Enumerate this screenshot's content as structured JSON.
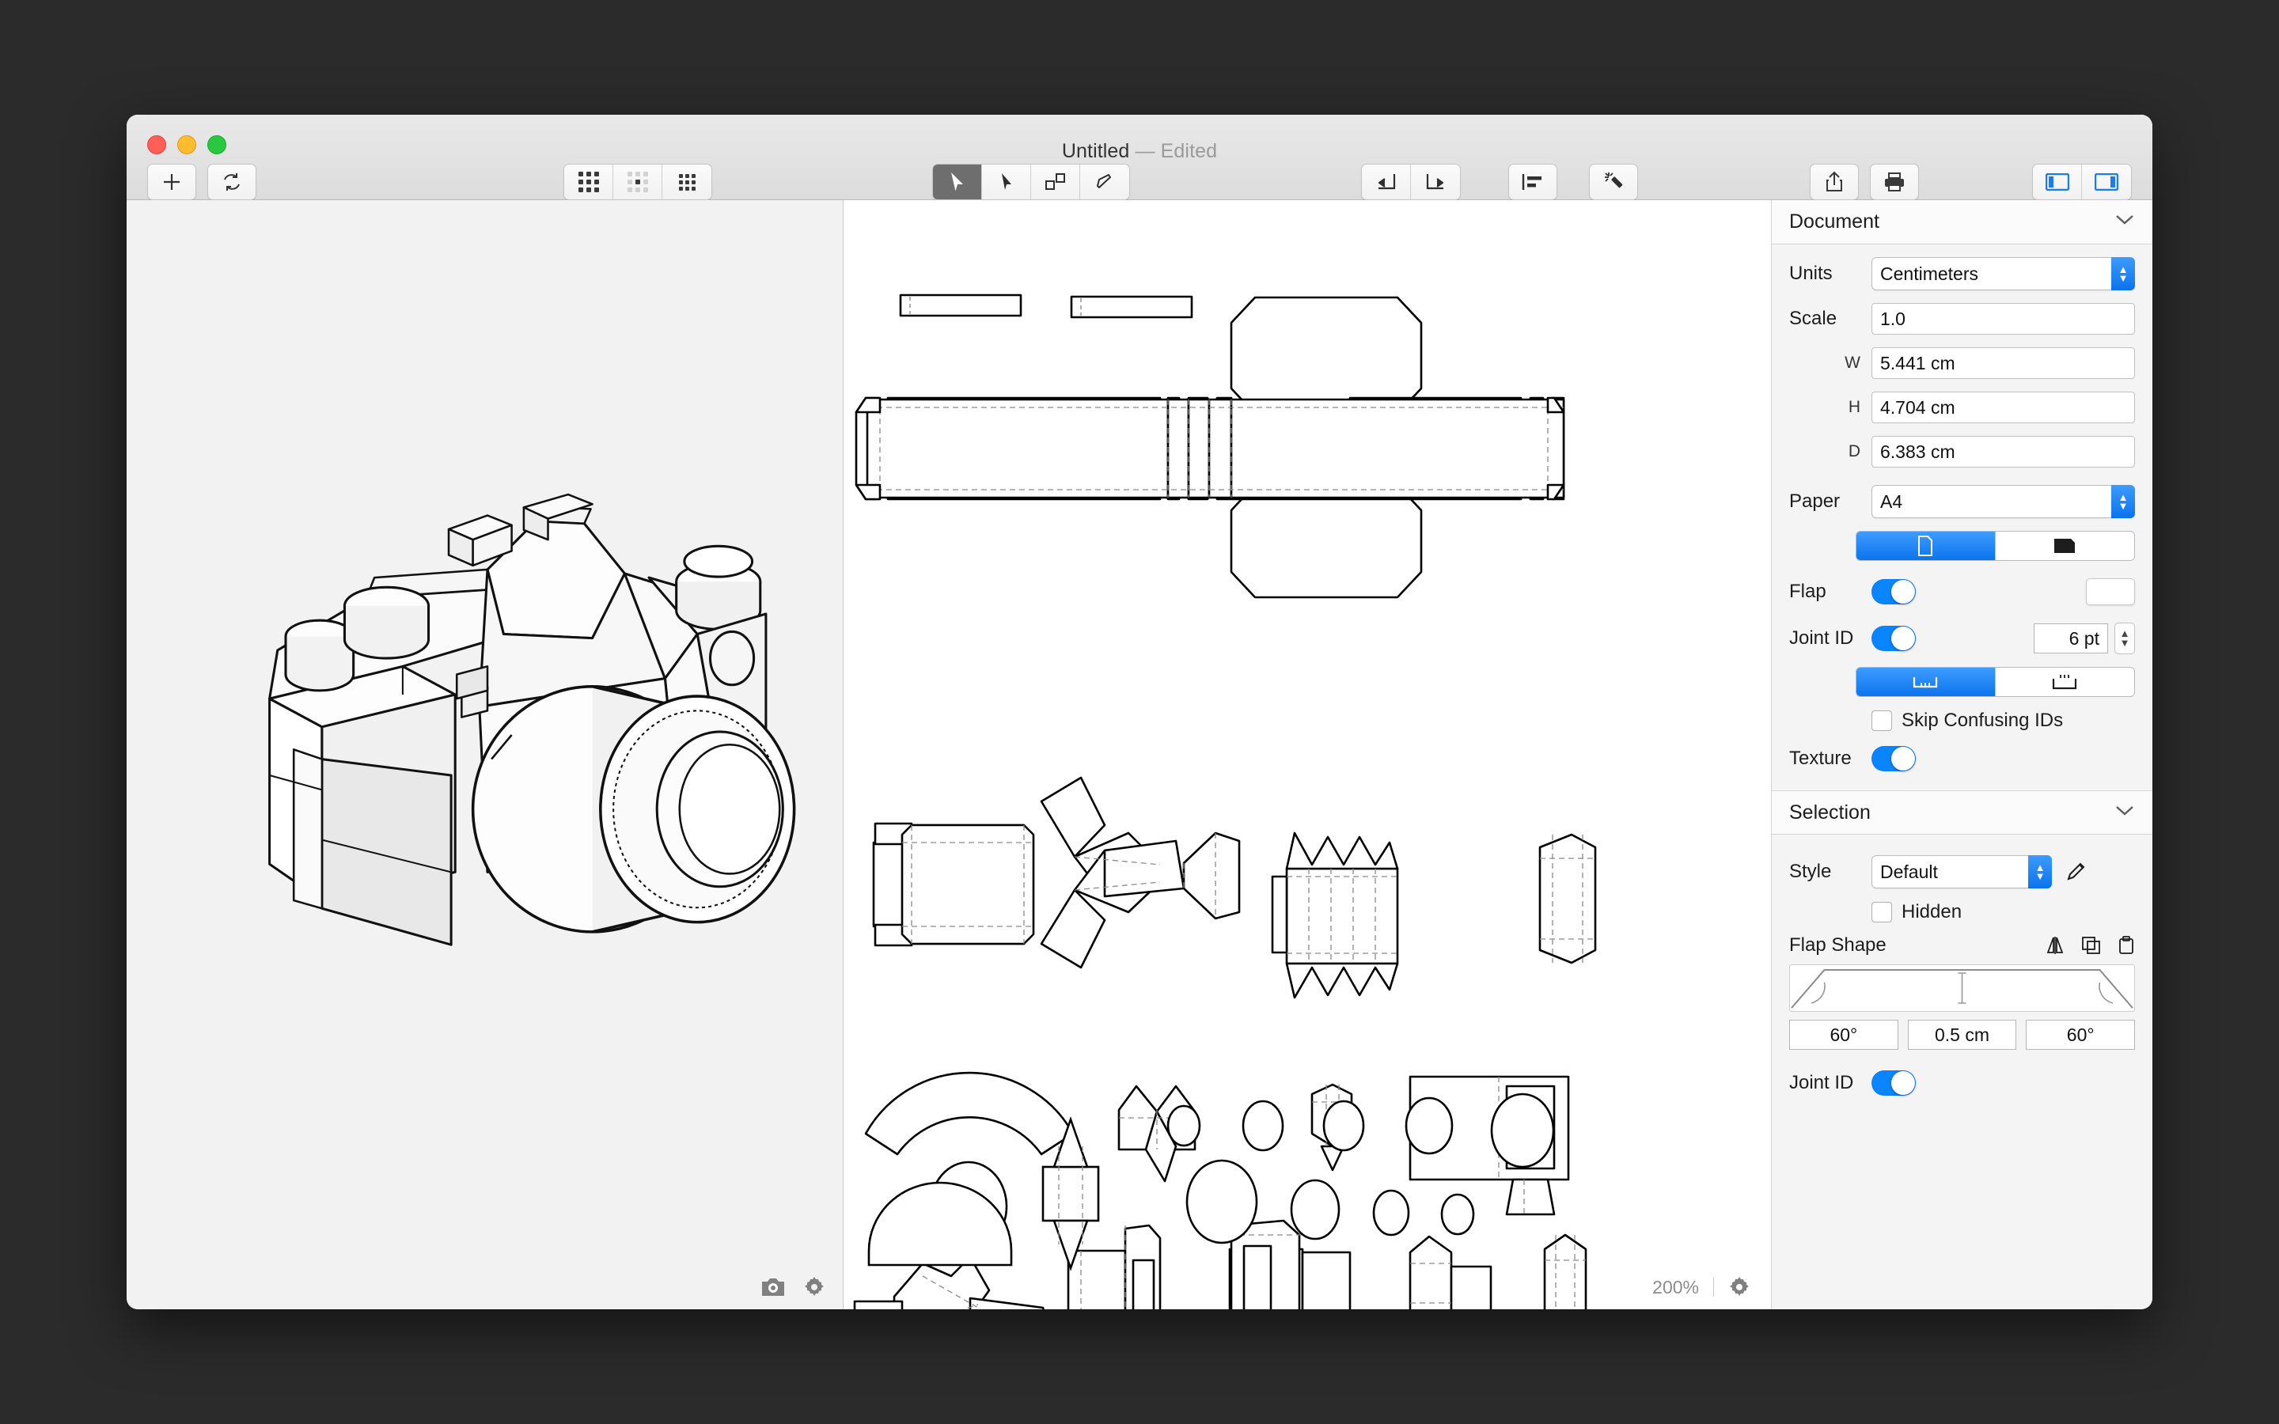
{
  "window": {
    "title": "Untitled",
    "title_suffix": "— Edited",
    "traffic_lights": [
      "close-button",
      "minimize-button",
      "zoom-button"
    ]
  },
  "toolbar": {
    "left": [
      {
        "name": "add-button",
        "icon": "plus-icon"
      },
      {
        "name": "refresh-button",
        "icon": "refresh-icon"
      }
    ],
    "view_group": [
      {
        "name": "view-all-faces",
        "icon": "grid-full-icon",
        "active": false
      },
      {
        "name": "view-selected-face",
        "icon": "grid-center-icon",
        "active": false
      },
      {
        "name": "view-dense-grid",
        "icon": "grid-dense-icon",
        "active": false
      }
    ],
    "tools_group": [
      {
        "name": "select-tool",
        "icon": "arrow-filled-icon",
        "active": true
      },
      {
        "name": "direct-select-tool",
        "icon": "arrow-outline-icon",
        "active": false
      },
      {
        "name": "separate-tool",
        "icon": "squares-icon",
        "active": false
      },
      {
        "name": "flap-tool",
        "icon": "flap-pen-icon",
        "active": false
      }
    ],
    "rotate_group": [
      {
        "name": "rotate-left-button",
        "icon": "rotate-ccw-icon"
      },
      {
        "name": "rotate-right-button",
        "icon": "rotate-cw-icon"
      }
    ],
    "align_button": {
      "name": "align-button",
      "icon": "align-left-icon"
    },
    "magic_button": {
      "name": "auto-unfold-button",
      "icon": "magic-wand-icon"
    },
    "share_button": {
      "name": "share-button",
      "icon": "share-icon"
    },
    "print_button": {
      "name": "print-button",
      "icon": "print-icon"
    },
    "panel_group": [
      {
        "name": "toggle-left-panel",
        "icon": "panel-left-icon"
      },
      {
        "name": "toggle-right-panel",
        "icon": "panel-right-icon"
      }
    ]
  },
  "preview": {
    "model_name": "camera-3d-model",
    "snapshot_button": "camera-icon",
    "settings_button": "gear-icon"
  },
  "canvas": {
    "zoom": "200%",
    "settings_button": "gear-icon"
  },
  "inspector": {
    "document": {
      "header": "Document",
      "units_label": "Units",
      "units_value": "Centimeters",
      "scale_label": "Scale",
      "scale_value": "1.0",
      "w_label": "W",
      "w_value": "5.441 cm",
      "h_label": "H",
      "h_value": "4.704 cm",
      "d_label": "D",
      "d_value": "6.383 cm",
      "paper_label": "Paper",
      "paper_value": "A4",
      "orientation": [
        {
          "name": "portrait-option",
          "icon": "page-portrait-icon",
          "selected": true
        },
        {
          "name": "landscape-option",
          "icon": "page-landscape-icon",
          "selected": false
        }
      ],
      "flap_label": "Flap",
      "flap_on": true,
      "joint_id_label": "Joint ID",
      "joint_id_on": true,
      "joint_id_size": "6 pt",
      "joint_style": [
        {
          "name": "joint-inside-option",
          "icon": "joint-inside-icon",
          "selected": true
        },
        {
          "name": "joint-outside-option",
          "icon": "joint-outside-icon",
          "selected": false
        }
      ],
      "skip_confusing_label": "Skip Confusing IDs",
      "skip_confusing_checked": false,
      "texture_label": "Texture",
      "texture_on": true
    },
    "selection": {
      "header": "Selection",
      "style_label": "Style",
      "style_value": "Default",
      "edit_style_icon": "pencil-icon",
      "hidden_label": "Hidden",
      "hidden_checked": false,
      "flap_shape_label": "Flap Shape",
      "flap_shape_tools": [
        {
          "name": "mirror-flap-button",
          "icon": "mirror-icon"
        },
        {
          "name": "copy-flap-button",
          "icon": "copy-icon"
        },
        {
          "name": "paste-flap-button",
          "icon": "paste-icon"
        }
      ],
      "angle_left": "60°",
      "height_value": "0.5 cm",
      "angle_right": "60°",
      "joint_id_label": "Joint ID",
      "joint_id_on": true
    }
  },
  "colors": {
    "accent": "#0a84ff",
    "desktop": "#2b2b2b",
    "panel_bg": "#f4f4f4",
    "preview_bg": "#f2f2f2"
  }
}
